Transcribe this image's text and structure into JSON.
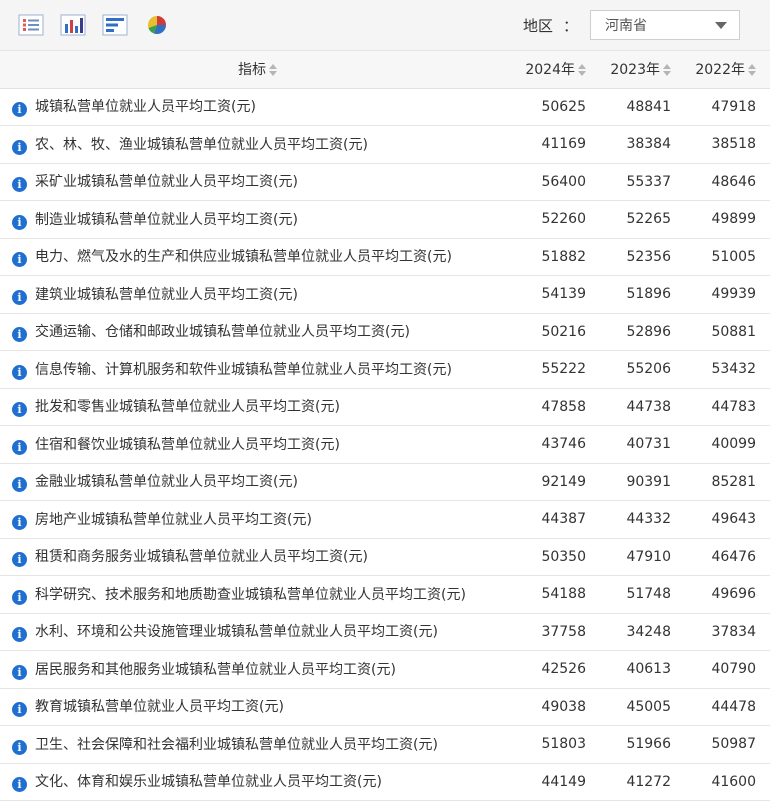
{
  "toolbar": {
    "icons": [
      "list-view-icon",
      "bar-chart-icon",
      "horizontal-bar-chart-icon",
      "pie-chart-icon"
    ],
    "region_label": "地区",
    "region_sep": "：",
    "region_value": "河南省"
  },
  "table": {
    "headers": {
      "name": "指标",
      "y2024": "2024年",
      "y2023": "2023年",
      "y2022": "2022年"
    },
    "rows": [
      {
        "name": "城镇私营单位就业人员平均工资(元)",
        "y2024": "50625",
        "y2023": "48841",
        "y2022": "47918"
      },
      {
        "name": "农、林、牧、渔业城镇私营单位就业人员平均工资(元)",
        "y2024": "41169",
        "y2023": "38384",
        "y2022": "38518"
      },
      {
        "name": "采矿业城镇私营单位就业人员平均工资(元)",
        "y2024": "56400",
        "y2023": "55337",
        "y2022": "48646"
      },
      {
        "name": "制造业城镇私营单位就业人员平均工资(元)",
        "y2024": "52260",
        "y2023": "52265",
        "y2022": "49899"
      },
      {
        "name": "电力、燃气及水的生产和供应业城镇私营单位就业人员平均工资(元)",
        "y2024": "51882",
        "y2023": "52356",
        "y2022": "51005"
      },
      {
        "name": "建筑业城镇私营单位就业人员平均工资(元)",
        "y2024": "54139",
        "y2023": "51896",
        "y2022": "49939"
      },
      {
        "name": "交通运输、仓储和邮政业城镇私营单位就业人员平均工资(元)",
        "y2024": "50216",
        "y2023": "52896",
        "y2022": "50881"
      },
      {
        "name": "信息传输、计算机服务和软件业城镇私营单位就业人员平均工资(元)",
        "y2024": "55222",
        "y2023": "55206",
        "y2022": "53432"
      },
      {
        "name": "批发和零售业城镇私营单位就业人员平均工资(元)",
        "y2024": "47858",
        "y2023": "44738",
        "y2022": "44783"
      },
      {
        "name": "住宿和餐饮业城镇私营单位就业人员平均工资(元)",
        "y2024": "43746",
        "y2023": "40731",
        "y2022": "40099"
      },
      {
        "name": "金融业城镇私营单位就业人员平均工资(元)",
        "y2024": "92149",
        "y2023": "90391",
        "y2022": "85281"
      },
      {
        "name": "房地产业城镇私营单位就业人员平均工资(元)",
        "y2024": "44387",
        "y2023": "44332",
        "y2022": "49643"
      },
      {
        "name": "租赁和商务服务业城镇私营单位就业人员平均工资(元)",
        "y2024": "50350",
        "y2023": "47910",
        "y2022": "46476"
      },
      {
        "name": "科学研究、技术服务和地质勘查业城镇私营单位就业人员平均工资(元)",
        "y2024": "54188",
        "y2023": "51748",
        "y2022": "49696"
      },
      {
        "name": "水利、环境和公共设施管理业城镇私营单位就业人员平均工资(元)",
        "y2024": "37758",
        "y2023": "34248",
        "y2022": "37834"
      },
      {
        "name": "居民服务和其他服务业城镇私营单位就业人员平均工资(元)",
        "y2024": "42526",
        "y2023": "40613",
        "y2022": "40790"
      },
      {
        "name": "教育城镇私营单位就业人员平均工资(元)",
        "y2024": "49038",
        "y2023": "45005",
        "y2022": "44478"
      },
      {
        "name": "卫生、社会保障和社会福利业城镇私营单位就业人员平均工资(元)",
        "y2024": "51803",
        "y2023": "51966",
        "y2022": "50987"
      },
      {
        "name": "文化、体育和娱乐业城镇私营单位就业人员平均工资(元)",
        "y2024": "44149",
        "y2023": "41272",
        "y2022": "41600"
      }
    ]
  }
}
